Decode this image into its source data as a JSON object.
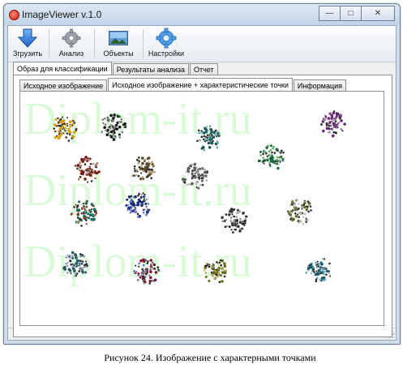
{
  "window": {
    "title": "ImageViewer v.1.0",
    "controls": [
      {
        "name": "minimize-button",
        "symbol": "—"
      },
      {
        "name": "maximize-button",
        "symbol": "□"
      },
      {
        "name": "close-button",
        "symbol": "✕"
      }
    ]
  },
  "toolbar": {
    "buttons": [
      {
        "label": "Згрузить",
        "icon": "download-arrow-icon"
      },
      {
        "label": "Анализ",
        "icon": "gear-icon"
      },
      {
        "label": "Объекты",
        "icon": "image-picture-icon"
      },
      {
        "label": "Настройки",
        "icon": "settings-gear-icon"
      }
    ]
  },
  "tabs_main": [
    {
      "label": "Образ для классификации",
      "active": true
    },
    {
      "label": "Результаты анализа",
      "active": false
    },
    {
      "label": "Отчет",
      "active": false
    }
  ],
  "tabs_sub": [
    {
      "label": "Исходное изображение",
      "active": false
    },
    {
      "label": "Исходное изображение + характеристические точки",
      "active": true
    },
    {
      "label": "Информация",
      "active": false
    }
  ],
  "watermark": {
    "text": "Diplom-it.ru"
  },
  "caption": "Рисунок 24. Изображение с характерными точками",
  "colors": {
    "watermark": "#90f090",
    "accent": "#3a86d8"
  }
}
